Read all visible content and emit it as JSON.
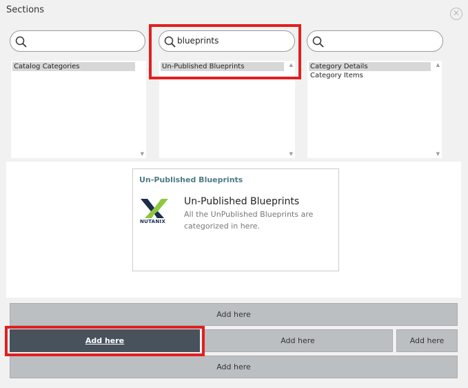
{
  "dialog": {
    "title": "Sections",
    "close_icon": "close-circle-icon"
  },
  "filters": [
    {
      "search_value": "",
      "items": [
        {
          "label": "Catalog Categories",
          "selected": true
        }
      ]
    },
    {
      "search_value": "blueprints",
      "items": [
        {
          "label": "Un-Published Blueprints",
          "selected": true
        }
      ]
    },
    {
      "search_value": "",
      "items": [
        {
          "label": "Category Details",
          "selected": true
        },
        {
          "label": "Category Items",
          "selected": false
        }
      ]
    }
  ],
  "preview": {
    "heading": "Un-Published Blueprints",
    "logo_text": "NUTANIX",
    "name": "Un-Published Blueprints",
    "description": "All the UnPublished Blueprints are categorized in here."
  },
  "drop_zones": {
    "row1": "Add here",
    "row2_left": "Add here",
    "row2_middle": "Add here",
    "row2_right": "Add here",
    "row3": "Add here"
  },
  "colors": {
    "highlight": "#e11f1f",
    "active_zone": "#48525d",
    "zone": "#bcbfc2",
    "heading": "#4d7a87",
    "logo_green": "#8dc63f",
    "logo_navy": "#1c2c4c"
  }
}
